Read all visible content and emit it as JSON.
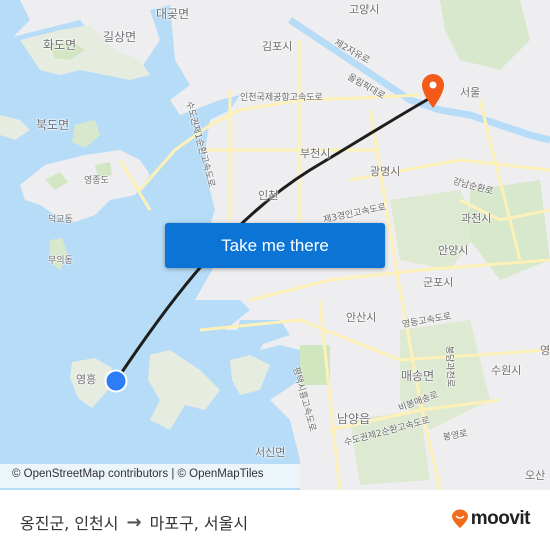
{
  "map": {
    "colors": {
      "water": "#b6dcf7",
      "land": "#eeeef0",
      "green": "#d2e6c3",
      "road": "#fdf1b8",
      "route": "#1e1e1e",
      "origin": "#2e7cf6",
      "destination": "#f35a1a"
    },
    "labels": {
      "hwado": "화도면",
      "gilsang": "길상면",
      "daegot": "대곶면",
      "gimpo": "김포시",
      "goyang": "고양시",
      "seoul": "서울",
      "bukdo": "북도면",
      "yeongjongdo": "영종도",
      "deokgyo": "덕교동",
      "mui": "무의동",
      "bucheon": "부천시",
      "gwangmyeong": "광명시",
      "gwacheon": "과천시",
      "anyang": "안양시",
      "gunpo": "군포시",
      "ansan": "안산시",
      "maesong": "매송면",
      "suwon": "수원시",
      "namyang": "남양읍",
      "seosin": "서신면",
      "yeongheung": "영흥",
      "osan": "오산",
      "incheon": "인천",
      "yeongtong": "영",
      "road_airport": "인천국제공항고속도로",
      "road_jayu": "제2자유로",
      "road_olympic": "올림픽대로",
      "road_ring1": "수도권제1순환고속도로",
      "road_gangnam": "강남순환로",
      "road_3rd_kyungin": "제3경인고속도로",
      "road_yeongdong": "영동고속도로",
      "road_pyeongtaek": "평택시흥고속도로",
      "road_ring2": "수도권제2순환고속도로",
      "road_bibong": "비봉매송로",
      "road_bongyeong": "봉영로",
      "road_gwacheon": "봉담과천로"
    }
  },
  "attribution": "© OpenStreetMap contributors | © OpenMapTiles",
  "cta": {
    "label": "Take me there"
  },
  "footer": {
    "origin": "옹진군, 인천시",
    "arrow": "→",
    "destination": "마포구, 서울시",
    "logo_text": "moovit",
    "logo_color": "#f26a1b"
  }
}
